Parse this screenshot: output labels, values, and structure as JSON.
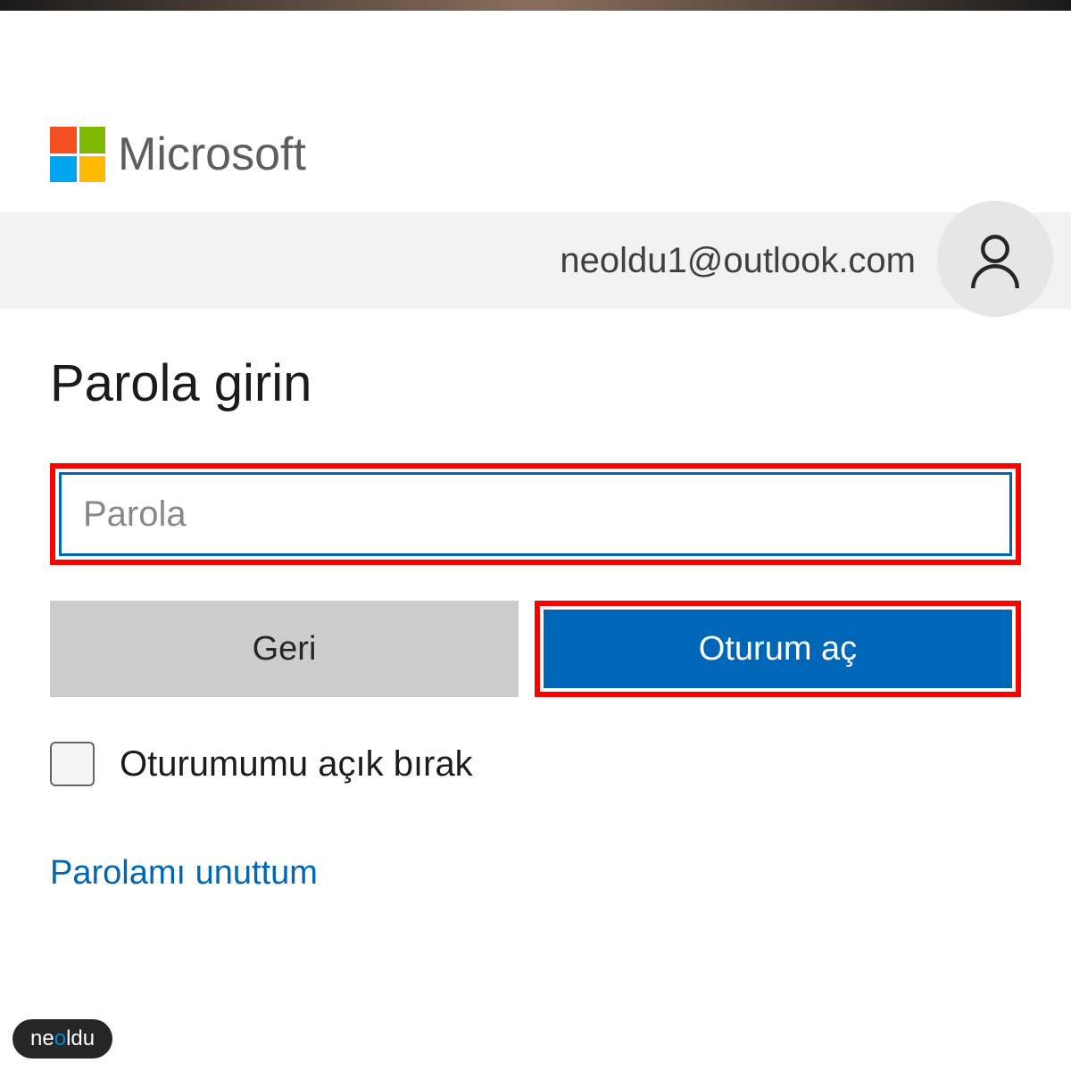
{
  "brand": {
    "name": "Microsoft"
  },
  "account": {
    "email": "neoldu1@outlook.com"
  },
  "form": {
    "title": "Parola girin",
    "password_placeholder": "Parola",
    "password_value": "",
    "back_label": "Geri",
    "signin_label": "Oturum aç",
    "keep_signed_label": "Oturumumu açık bırak",
    "forgot_label": "Parolamı unuttum"
  },
  "watermark": {
    "prefix": "ne",
    "accent": "o",
    "suffix": "ldu"
  },
  "colors": {
    "accent": "#0067b8",
    "highlight": "#ff0000"
  }
}
